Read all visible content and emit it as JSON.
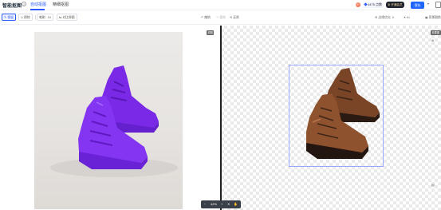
{
  "header": {
    "logo": "智能抠图",
    "help_glyph": "?",
    "tabs": [
      {
        "label": "自动抠图",
        "active": true
      },
      {
        "label": "精细抠图",
        "active": false
      }
    ],
    "credits": "4475 点数",
    "member_label": "开通会员",
    "download_label": "保存"
  },
  "toolbar": {
    "keep_label": "保留",
    "erase_label": "擦除",
    "brush_label": "笔刷",
    "brush_size": "10",
    "compare_label": "对比原图",
    "undo_label": "撤销",
    "redo_label": "重做",
    "reset_label": "还原",
    "edge_label": "边缘优化",
    "edge_value": "0",
    "ai_label": "AI",
    "bg_label": "背景替换"
  },
  "canvas": {
    "left_tag": "原图",
    "right_tag": "效果图",
    "zoom_value": "42%"
  },
  "colors": {
    "accent": "#2b59ff",
    "mask": "#7b2cf0",
    "shoe": "#8a4e2c"
  }
}
